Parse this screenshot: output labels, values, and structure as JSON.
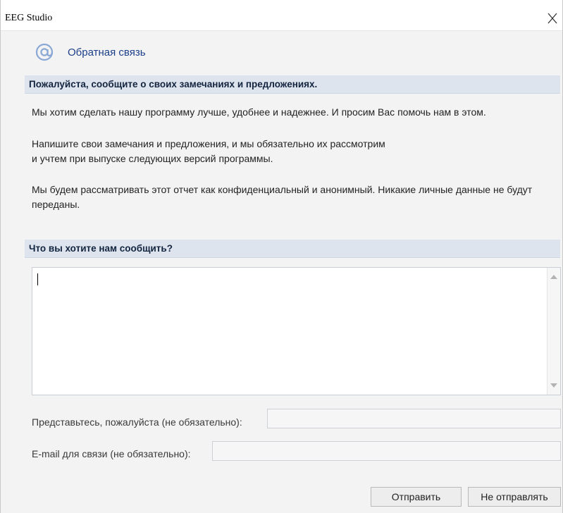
{
  "window": {
    "title": "EEG Studio"
  },
  "header": {
    "title": "Обратная связь",
    "icon": "at-sign-icon",
    "accent_color": "#1b3f8a"
  },
  "intro_section": {
    "heading": "Пожалуйста, сообщите о своих замечаниях и предложениях.",
    "paragraphs": [
      "Мы хотим сделать нашу программу лучше, удобнее и надежнее. И просим Вас помочь нам в этом.",
      "Напишите свои замечания и предложения, и мы обязательно их рассмотрим\nи учтем при выпуске следующих версий программы.",
      "Мы будем рассматривать этот отчет как конфиденциальный и анонимный. Никакие личные данные не будут переданы."
    ]
  },
  "message_section": {
    "heading": "Что вы хотите нам сообщить?",
    "message_value": ""
  },
  "form": {
    "name_label": "Представьтесь, пожалуйста (не обязательно):",
    "name_value": "",
    "email_label": "E-mail для связи (не обязательно):",
    "email_value": ""
  },
  "buttons": {
    "send_label": "Отправить",
    "dont_send_label": "Не отправлять"
  },
  "colors": {
    "section_bar": "#dde4ee",
    "dialog_background": "#f3f3f3"
  }
}
